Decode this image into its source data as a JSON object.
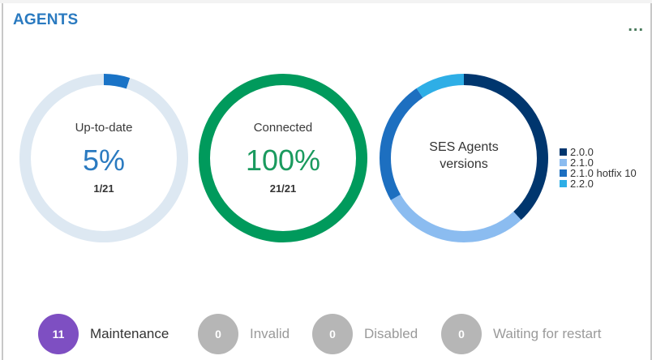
{
  "card": {
    "title": "AGENTS",
    "menu_label": "..."
  },
  "donuts": {
    "up_to_date": {
      "label": "Up-to-date",
      "value": "5%",
      "count": "1/21",
      "fraction": 0.05,
      "track_color": "#dde8f2",
      "fill_color": "#1a73c6",
      "value_color": "#2a7ac0"
    },
    "connected": {
      "label": "Connected",
      "value": "100%",
      "count": "21/21",
      "fraction": 1.0,
      "fill_color": "#009a5c",
      "value_color": "#1a9a5e"
    },
    "versions": {
      "label_line1": "SES Agents",
      "label_line2": "versions"
    }
  },
  "chart_data": {
    "type": "pie",
    "title": "SES Agents versions",
    "categories": [
      "2.0.0",
      "2.1.0",
      "2.1.0 hotfix 10",
      "2.2.0"
    ],
    "values": [
      8,
      6,
      5,
      2
    ],
    "colors": [
      "#00366e",
      "#8bbcf0",
      "#1d6fc0",
      "#2eaee6"
    ],
    "legend": "right"
  },
  "legend": {
    "items": [
      {
        "label": "2.0.0",
        "color": "#00366e"
      },
      {
        "label": "2.1.0",
        "color": "#8bbcf0"
      },
      {
        "label": "2.1.0 hotfix 10",
        "color": "#1d6fc0"
      },
      {
        "label": "2.2.0",
        "color": "#2eaee6"
      }
    ]
  },
  "status": {
    "maintenance": {
      "count": "11",
      "label": "Maintenance",
      "circle_color": "#7e4fc2",
      "label_color": "#333333"
    },
    "invalid": {
      "count": "0",
      "label": "Invalid",
      "circle_color": "#b6b6b6",
      "label_color": "#9a9a9a"
    },
    "disabled": {
      "count": "0",
      "label": "Disabled",
      "circle_color": "#b6b6b6",
      "label_color": "#9a9a9a"
    },
    "waiting": {
      "count": "0",
      "label": "Waiting for restart",
      "circle_color": "#b6b6b6",
      "label_color": "#9a9a9a"
    }
  },
  "icons": {
    "more_menu": "more-horizontal-icon"
  }
}
